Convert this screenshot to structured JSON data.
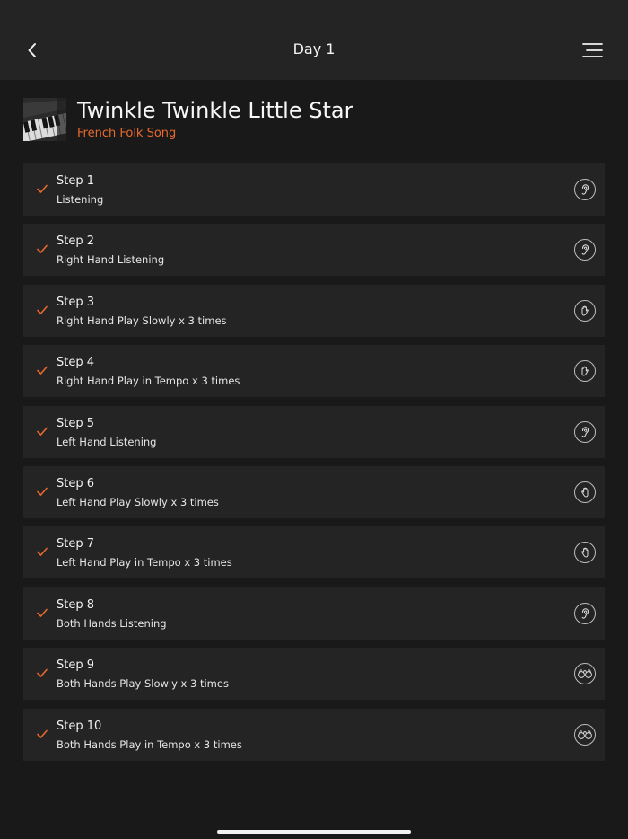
{
  "header": {
    "title": "Day 1",
    "back_icon": "chevron-left-icon",
    "menu_icon": "hamburger-menu-icon"
  },
  "song": {
    "title": "Twinkle Twinkle Little Star",
    "subtitle": "French Folk Song",
    "accent_color": "#e8692e"
  },
  "steps": [
    {
      "title": "Step 1",
      "desc": "Listening",
      "icon": "ear-icon",
      "done": true
    },
    {
      "title": "Step 2",
      "desc": "Right Hand Listening",
      "icon": "ear-icon",
      "done": true
    },
    {
      "title": "Step 3",
      "desc": "Right Hand Play Slowly x 3 times",
      "icon": "right-hand-icon",
      "done": true
    },
    {
      "title": "Step 4",
      "desc": "Right Hand Play in Tempo x 3 times",
      "icon": "right-hand-icon",
      "done": true
    },
    {
      "title": "Step 5",
      "desc": "Left Hand Listening",
      "icon": "ear-icon",
      "done": true
    },
    {
      "title": "Step 6",
      "desc": "Left Hand Play Slowly x 3 times",
      "icon": "left-hand-icon",
      "done": true
    },
    {
      "title": "Step 7",
      "desc": "Left Hand Play in Tempo x 3 times",
      "icon": "left-hand-icon",
      "done": true
    },
    {
      "title": "Step 8",
      "desc": "Both Hands Listening",
      "icon": "ear-icon",
      "done": true
    },
    {
      "title": "Step 9",
      "desc": "Both Hands Play Slowly x 3 times",
      "icon": "both-hands-icon",
      "done": true
    },
    {
      "title": "Step 10",
      "desc": "Both Hands Play in Tempo x 3 times",
      "icon": "both-hands-icon",
      "done": true
    }
  ]
}
